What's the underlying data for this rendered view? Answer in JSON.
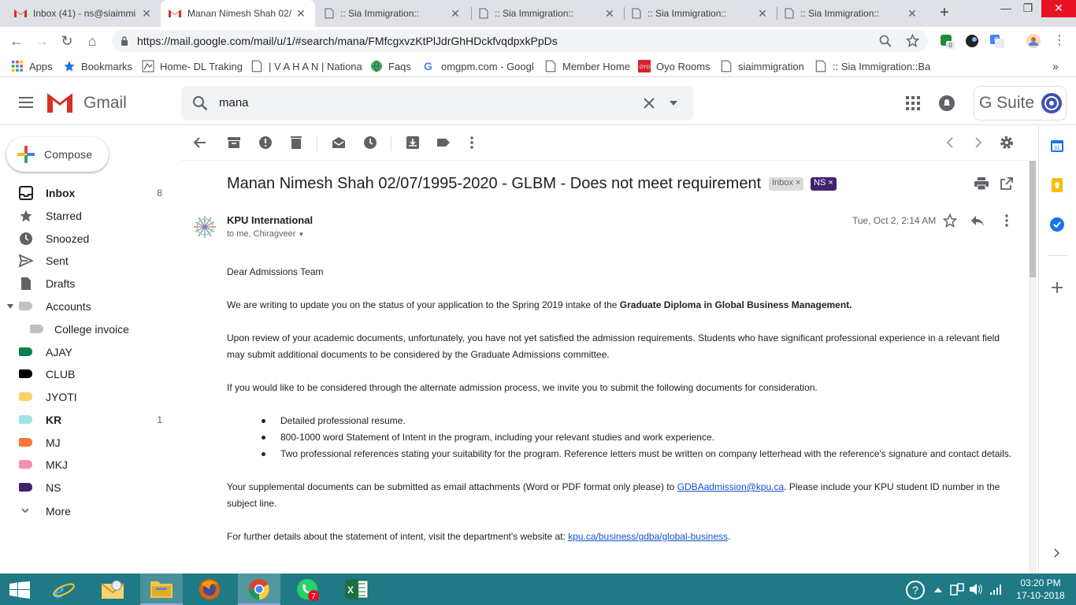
{
  "browser": {
    "tabs": [
      {
        "title": "Inbox (41) - ns@siaimmi",
        "icon": "gmail-icon"
      },
      {
        "title": "Manan Nimesh Shah 02/",
        "icon": "gmail-icon"
      },
      {
        "title": ":: Sia Immigration::",
        "icon": "page-icon"
      },
      {
        "title": ":: Sia Immigration::",
        "icon": "page-icon"
      },
      {
        "title": ":: Sia Immigration::",
        "icon": "page-icon"
      },
      {
        "title": ":: Sia Immigration::",
        "icon": "page-icon"
      }
    ],
    "url": "https://mail.google.com/mail/u/1/#search/mana/FMfcgxvzKtPlJdrGhHDckfvqdpxkPpDs",
    "extension_badge": "0",
    "bookmarks": [
      "Apps",
      "Bookmarks",
      "Home- DL Traking",
      "| V A H A N | Nationa",
      "Faqs",
      "omgpm.com - Googl",
      "Member Home",
      "Oyo Rooms",
      "siaimmigration",
      ":: Sia Immigration::Ba"
    ]
  },
  "gmail": {
    "logo_text": "Gmail",
    "search_query": "mana",
    "gsuite_label": "G Suite",
    "compose_label": "Compose",
    "nav": [
      {
        "label": "Inbox",
        "count": "8",
        "bold": true,
        "icon": "inbox-icon"
      },
      {
        "label": "Starred",
        "count": "",
        "icon": "star-icon"
      },
      {
        "label": "Snoozed",
        "count": "",
        "icon": "clock-icon"
      },
      {
        "label": "Sent",
        "count": "",
        "icon": "send-icon"
      },
      {
        "label": "Drafts",
        "count": "",
        "icon": "draft-icon"
      },
      {
        "label": "Accounts",
        "count": "",
        "icon": "label-icon",
        "color": "#c2c2c2"
      },
      {
        "label": "College invoice",
        "count": "",
        "icon": "label-icon",
        "color": "#c2c2c2"
      },
      {
        "label": "AJAY",
        "count": "",
        "color": "#0b804b"
      },
      {
        "label": "CLUB",
        "count": "",
        "color": "#000000"
      },
      {
        "label": "JYOTI",
        "count": "",
        "color": "#fad165"
      },
      {
        "label": "KR",
        "count": "1",
        "bold": true,
        "color": "#9fe1e7"
      },
      {
        "label": "MJ",
        "count": "",
        "color": "#ff7537"
      },
      {
        "label": "MKJ",
        "count": "",
        "color": "#f691b2"
      },
      {
        "label": "NS",
        "count": "",
        "color": "#41236d"
      }
    ],
    "more_label": "More"
  },
  "message": {
    "subject": "Manan Nimesh Shah 02/07/1995-2020 - GLBM - Does not meet requirement",
    "labels": [
      {
        "name": "Inbox",
        "bg": "#dddddd",
        "fg": "#666666"
      },
      {
        "name": "NS",
        "bg": "#41236d",
        "fg": "#ffffff"
      }
    ],
    "sender": "KPU International",
    "recipients": "to me, Chiragveer",
    "date": "Tue, Oct 2, 2:14 AM",
    "greeting": "Dear Admissions Team",
    "p1_text": "We are writing to update you on the status of your application to the Spring 2019 intake of the ",
    "p1_bold": "Graduate Diploma in Global Business Management.",
    "p2": "Upon review of your academic documents, unfortunately, you have not yet satisfied the admission requirements. Students who have significant professional experience in a relevant field may submit additional documents to be considered by the Graduate Admissions committee.",
    "p3": "If you would like to be considered through the alternate admission process, we invite you to submit the following documents for consideration.",
    "bullets": [
      "Detailed professional resume.",
      "800-1000 word Statement of Intent in the program, including your relevant studies and work experience.",
      "Two professional references stating your suitability for the program. Reference letters must be written on company letterhead with the reference's signature and contact details."
    ],
    "p4_pre": "Your supplemental documents can be submitted as email attachments (Word or PDF format only please) to ",
    "p4_link": "GDBAadmission@kpu.ca",
    "p4_post": ". Please include your KPU student ID number in the subject line.",
    "p5_pre": "For further details about the statement of intent, visit the department's website at: ",
    "p5_link": "kpu.ca/business/gdba/global-business",
    "p5_post": "."
  },
  "taskbar": {
    "whatsapp_badge": "7",
    "time": "03:20 PM",
    "date": "17-10-2018"
  }
}
